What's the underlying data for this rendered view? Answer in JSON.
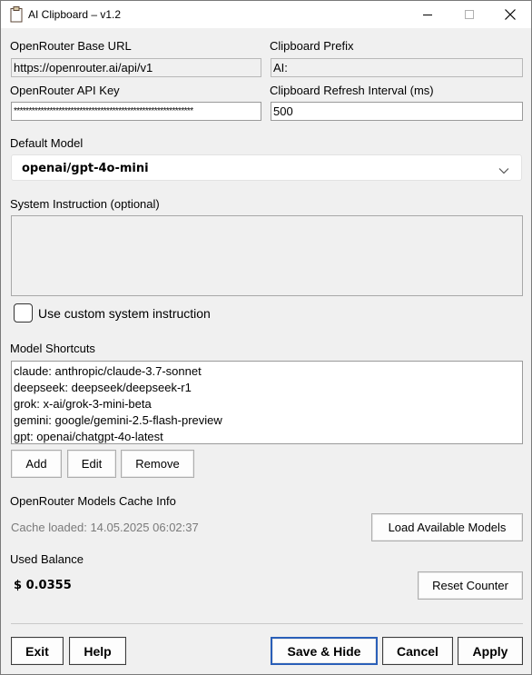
{
  "window": {
    "title": "AI Clipboard – v1.2",
    "minimize_icon": "minimize-icon",
    "maximize_icon": "maximize-icon",
    "close_icon": "close-icon"
  },
  "settings": {
    "base_url": {
      "label": "OpenRouter Base URL",
      "value": "https://openrouter.ai/api/v1"
    },
    "prefix": {
      "label": "Clipboard Prefix",
      "value": "AI:"
    },
    "api_key": {
      "label": "OpenRouter API Key",
      "value": "************************************************************"
    },
    "refresh": {
      "label": "Clipboard Refresh Interval (ms)",
      "value": "500"
    },
    "default_model": {
      "label": "Default Model",
      "value": "openai/gpt-4o-mini"
    },
    "system_instruction": {
      "label": "System Instruction (optional)",
      "value": ""
    },
    "use_custom": {
      "label": "Use custom system instruction",
      "checked": false
    }
  },
  "shortcuts": {
    "label": "Model Shortcuts",
    "items": [
      "claude: anthropic/claude-3.7-sonnet",
      "deepseek: deepseek/deepseek-r1",
      "grok: x-ai/grok-3-mini-beta",
      "gemini: google/gemini-2.5-flash-preview",
      "gpt: openai/chatgpt-4o-latest"
    ],
    "add_label": "Add",
    "edit_label": "Edit",
    "remove_label": "Remove"
  },
  "cache": {
    "label": "OpenRouter Models Cache Info",
    "status": "Cache loaded: 14.05.2025 06:02:37",
    "load_label": "Load Available Models"
  },
  "balance": {
    "label": "Used Balance",
    "value": "$ 0.0355",
    "reset_label": "Reset Counter"
  },
  "footer": {
    "exit_label": "Exit",
    "help_label": "Help",
    "save_label": "Save & Hide",
    "cancel_label": "Cancel",
    "apply_label": "Apply"
  },
  "colors": {
    "window_bg": "#f0f0f0",
    "primary_border": "#2a5fb8",
    "muted_text": "#7a7a7a"
  }
}
